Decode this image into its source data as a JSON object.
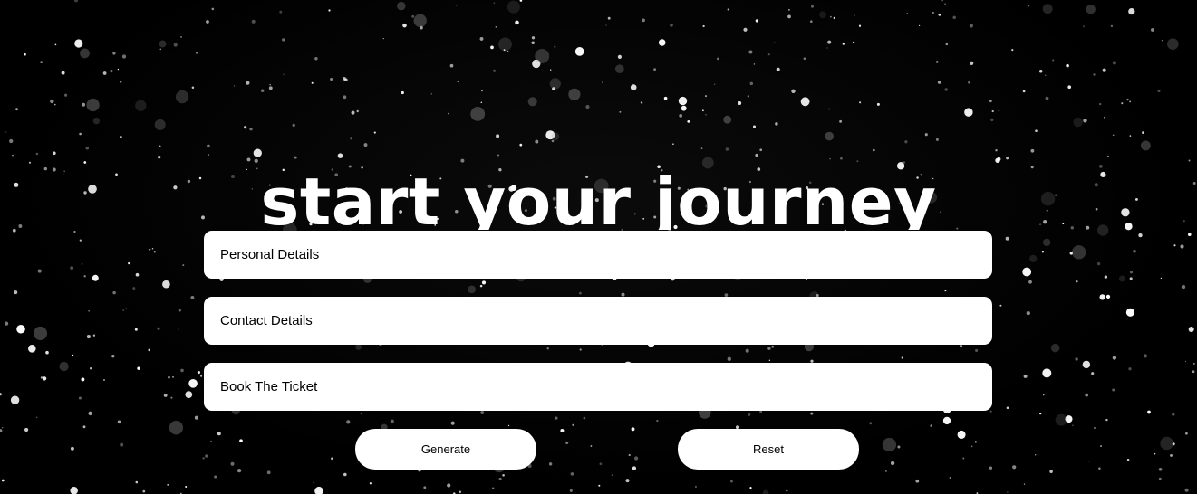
{
  "page": {
    "title": "start your journey"
  },
  "sections": {
    "personal_label": "Personal Details",
    "contact_label": "Contact Details",
    "book_label": "Book The Ticket"
  },
  "actions": {
    "generate_label": "Generate",
    "reset_label": "Reset"
  },
  "colors": {
    "background": "#000000",
    "panel": "#ffffff",
    "text_dark": "#000000",
    "text_light": "#ffffff"
  }
}
